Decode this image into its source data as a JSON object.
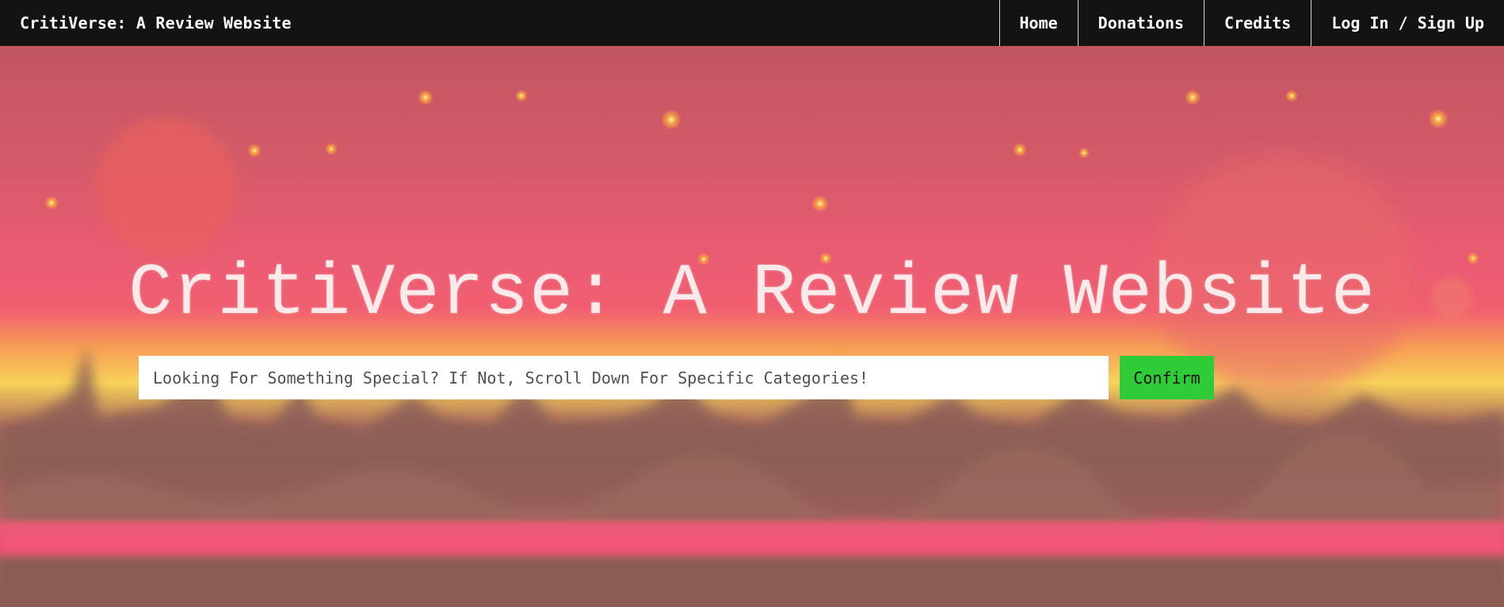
{
  "header": {
    "brand": "CritiVerse: A Review Website",
    "nav": [
      {
        "label": "Home"
      },
      {
        "label": "Donations"
      },
      {
        "label": "Credits"
      },
      {
        "label": "Log In / Sign Up"
      }
    ]
  },
  "hero": {
    "title": "CritiVerse: A Review Website",
    "search": {
      "placeholder": "Looking For Something Special? If Not, Scroll Down For Specific Categories!",
      "value": ""
    },
    "confirm_label": "Confirm"
  },
  "colors": {
    "navbar_bg": "#131313",
    "confirm_button": "#2fcc37",
    "hero_pink": "#f15f70",
    "hero_yellow": "#f8d25a"
  }
}
